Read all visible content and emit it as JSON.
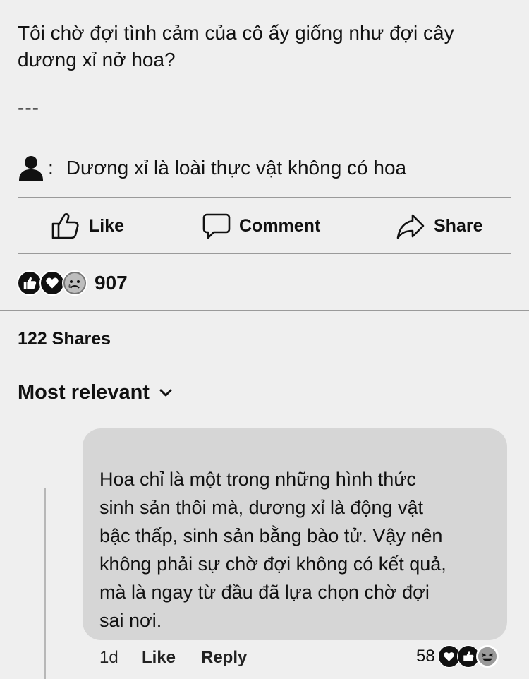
{
  "post": {
    "text_line1": "Tôi chờ đợi tình cảm của cô ấy giống như đợi cây",
    "text_line2": "dương xỉ nở hoa?",
    "separator": "---",
    "quote_colon": ":",
    "quote_text": "Dương xỉ là loài thực vật không có hoa"
  },
  "actions": {
    "like": "Like",
    "comment": "Comment",
    "share": "Share"
  },
  "reactions": {
    "icons": [
      "like-reaction-icon",
      "love-reaction-icon",
      "sad-reaction-icon"
    ],
    "count": "907"
  },
  "shares_text": "122 Shares",
  "sort_label": "Most relevant",
  "comment": {
    "lines": [
      "Hoa chỉ là một trong những hình thức",
      "sinh sản thôi mà, dương xỉ là động vật",
      "bậc thấp, sinh sản bằng bào tử. Vậy nên",
      "không phải sự chờ đợi không có kết quả,",
      "mà là ngay từ đầu đã lựa chọn chờ đợi",
      "sai nơi."
    ],
    "time": "1d",
    "like_label": "Like",
    "reply_label": "Reply",
    "reaction_count": "58",
    "reaction_icons": [
      "love-reaction-icon",
      "like-reaction-icon",
      "haha-reaction-icon"
    ]
  },
  "colors": {
    "background": "#efefef",
    "bubble": "#d6d6d6",
    "divider": "#9a9a9a"
  }
}
